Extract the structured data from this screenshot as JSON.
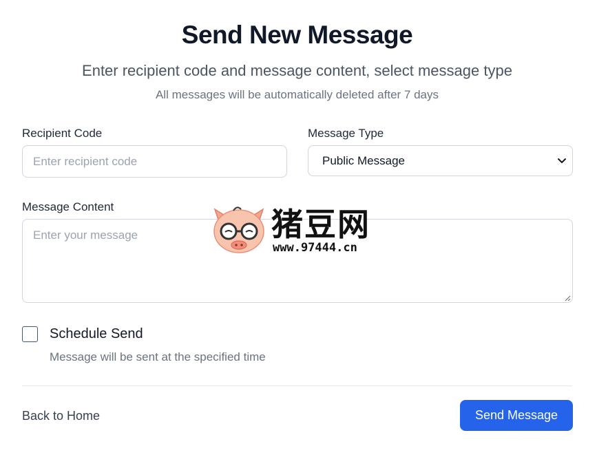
{
  "header": {
    "title": "Send New Message",
    "subtitle": "Enter recipient code and message content, select message type",
    "note": "All messages will be automatically deleted after 7 days"
  },
  "form": {
    "recipient": {
      "label": "Recipient Code",
      "placeholder": "Enter recipient code",
      "value": ""
    },
    "message_type": {
      "label": "Message Type",
      "selected": "Public Message"
    },
    "content": {
      "label": "Message Content",
      "placeholder": "Enter your message",
      "value": ""
    },
    "schedule": {
      "label": "Schedule Send",
      "help": "Message will be sent at the specified time",
      "checked": false
    }
  },
  "footer": {
    "back_label": "Back to Home",
    "send_label": "Send Message"
  },
  "watermark": {
    "name": "猪豆网",
    "url": "www.97444.cn"
  },
  "colors": {
    "primary": "#2563eb",
    "title": "#111827",
    "muted": "#6b7280",
    "border": "#d1d5db"
  },
  "icons": {
    "select_arrow": "chevron-down-icon",
    "resize_handle": "resize-grip-icon",
    "logo": "pig-logo-icon"
  }
}
